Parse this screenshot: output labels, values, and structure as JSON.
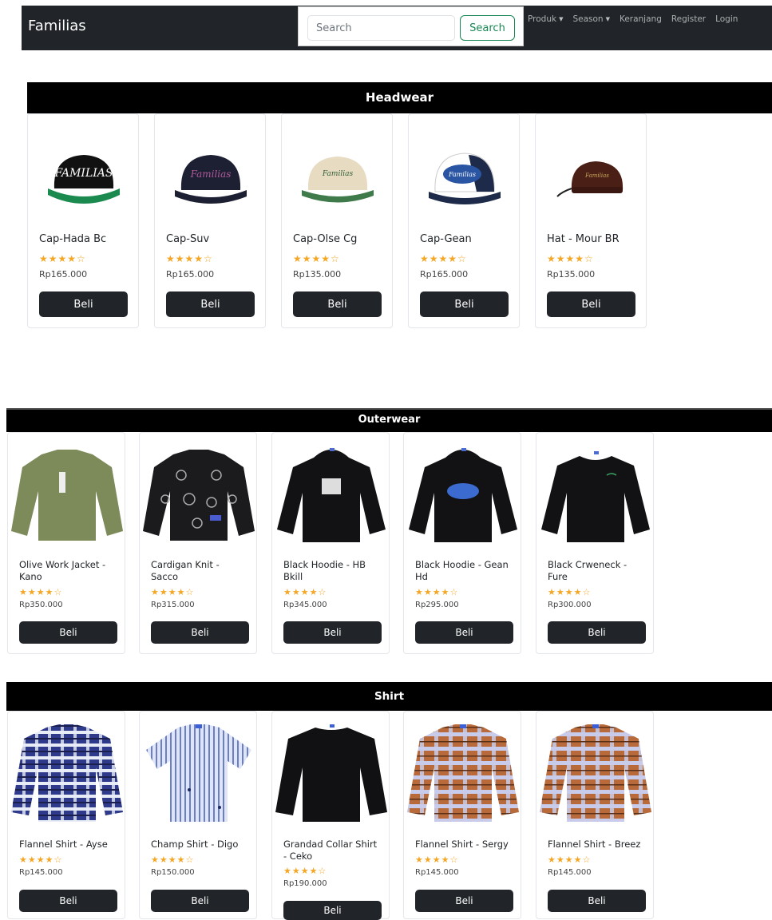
{
  "navbar": {
    "brand": "Familias",
    "search_placeholder": "Search",
    "search_button": "Search",
    "links": [
      "Produk",
      "Season",
      "Keranjang",
      "Register",
      "Login"
    ]
  },
  "sections": [
    {
      "title": "Headwear",
      "products": [
        {
          "name": "Cap-Hada Bc",
          "stars": "★★★★☆",
          "price": "Rp165.000",
          "button": "Beli"
        },
        {
          "name": "Cap-Suv",
          "stars": "★★★★☆",
          "price": "Rp165.000",
          "button": "Beli"
        },
        {
          "name": "Cap-Olse Cg",
          "stars": "★★★★☆",
          "price": "Rp135.000",
          "button": "Beli"
        },
        {
          "name": "Cap-Gean",
          "stars": "★★★★☆",
          "price": "Rp165.000",
          "button": "Beli"
        },
        {
          "name": "Hat - Mour BR",
          "stars": "★★★★☆",
          "price": "Rp135.000",
          "button": "Beli"
        }
      ]
    },
    {
      "title": "Outerwear",
      "products": [
        {
          "name": "Olive Work Jacket - Kano",
          "stars": "★★★★☆",
          "price": "Rp350.000",
          "button": "Beli"
        },
        {
          "name": "Cardigan Knit - Sacco",
          "stars": "★★★★☆",
          "price": "Rp315.000",
          "button": "Beli"
        },
        {
          "name": "Black Hoodie - HB Bkill",
          "stars": "★★★★☆",
          "price": "Rp345.000",
          "button": "Beli"
        },
        {
          "name": "Black Hoodie - Gean Hd",
          "stars": "★★★★☆",
          "price": "Rp295.000",
          "button": "Beli"
        },
        {
          "name": "Black Crweneck - Fure",
          "stars": "★★★★☆",
          "price": "Rp300.000",
          "button": "Beli"
        }
      ]
    },
    {
      "title": "Shirt",
      "products": [
        {
          "name": "Flannel Shirt - Ayse",
          "stars": "★★★★☆",
          "price": "Rp145.000",
          "button": "Beli"
        },
        {
          "name": "Champ Shirt - Digo",
          "stars": "★★★★☆",
          "price": "Rp150.000",
          "button": "Beli"
        },
        {
          "name": "Grandad Collar Shirt - Ceko",
          "stars": "★★★★☆",
          "price": "Rp190.000",
          "button": "Beli"
        },
        {
          "name": "Flannel Shirt - Sergy",
          "stars": "★★★★☆",
          "price": "Rp145.000",
          "button": "Beli"
        },
        {
          "name": "Flannel Shirt - Breez",
          "stars": "★★★★☆",
          "price": "Rp145.000",
          "button": "Beli"
        }
      ]
    }
  ],
  "colors": {
    "navbar": "#212529",
    "header": "#000000",
    "star": "#f5a623",
    "search_button": "#198754"
  }
}
